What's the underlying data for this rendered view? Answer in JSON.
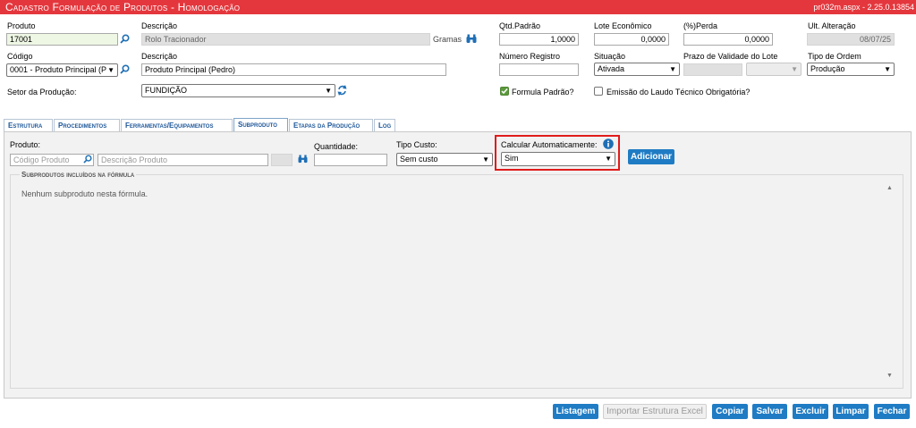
{
  "window": {
    "title": "Cadastro Formulação de Produtos  - Homologação",
    "version": "pr032m.aspx - 2.25.0.13854"
  },
  "header": {
    "produto": {
      "label": "Produto",
      "value": "17001"
    },
    "descricao": {
      "label": "Descrição",
      "value": "Rolo Tracionador",
      "unit": "Gramas"
    },
    "qtd_padrao": {
      "label": "Qtd.Padrão",
      "value": "1,0000"
    },
    "lote_economico": {
      "label": "Lote Econômico",
      "value": "0,0000"
    },
    "perda": {
      "label": "(%)Perda",
      "value": "0,0000"
    },
    "ult_alteracao": {
      "label": "Ult. Alteração",
      "value": "08/07/25"
    },
    "codigo": {
      "label": "Código",
      "value": "0001 - Produto Principal (P"
    },
    "descricao2": {
      "label": "Descrição",
      "value": "Produto Principal (Pedro)"
    },
    "numero_registro": {
      "label": "Número Registro",
      "value": ""
    },
    "situacao": {
      "label": "Situação",
      "value": "Ativada"
    },
    "prazo_validade": {
      "label": "Prazo de Validade do Lote",
      "value": ""
    },
    "tipo_ordem": {
      "label": "Tipo de Ordem",
      "value": "Produção"
    },
    "setor": {
      "label": "Setor da Produção:",
      "value": "FUNDIÇÃO"
    },
    "formula_padrao": {
      "label": "Formula Padrão?",
      "checked": true
    },
    "emissao_laudo": {
      "label": "Emissão do Laudo Técnico Obrigatória?",
      "checked": false
    }
  },
  "tabs": [
    {
      "label": "Estrutura",
      "active": false
    },
    {
      "label": "Procedimentos",
      "active": false
    },
    {
      "label": "Ferramentas/Equipamentos",
      "active": false
    },
    {
      "label": "Subproduto",
      "active": true
    },
    {
      "label": "Etapas da Produção",
      "active": false
    },
    {
      "label": "Log",
      "active": false
    }
  ],
  "subproduto": {
    "produto_label": "Produto:",
    "codigo_placeholder": "Código Produto",
    "descricao_placeholder": "Descrição Produto",
    "quantidade_label": "Quantidade:",
    "tipo_custo_label": "Tipo Custo:",
    "tipo_custo_value": "Sem custo",
    "calcular_label": "Calcular Automaticamente:",
    "calcular_value": "Sim",
    "adicionar": "Adicionar",
    "group_title": "Subprodutos incluídos na fórmula",
    "empty_message": "Nenhum subproduto nesta fórmula."
  },
  "footer": {
    "listagem": "Listagem",
    "importar": "Importar Estrutura Excel",
    "copiar": "Copiar",
    "salvar": "Salvar",
    "excluir": "Excluir",
    "limpar": "Limpar",
    "fechar": "Fechar"
  },
  "colors": {
    "titlebar": "#e4373d",
    "button": "#1f7cc4",
    "tab_text": "#1e5799",
    "highlight": "#e01b1b"
  },
  "icons": [
    "search-icon",
    "binoculars-icon",
    "refresh-icon",
    "info-icon",
    "chevron-down-icon",
    "scroll-up-icon",
    "scroll-down-icon"
  ]
}
